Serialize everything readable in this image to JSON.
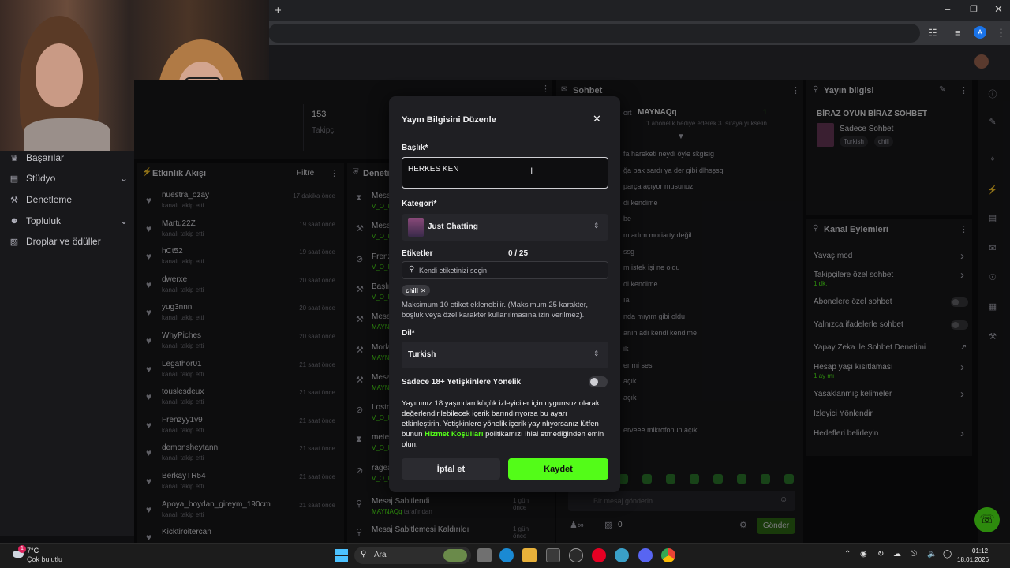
{
  "browser": {
    "new_tab": "+",
    "avatar_letter": "A"
  },
  "sidebar": {
    "items": [
      {
        "label": "Başarılar",
        "icon": "trophy-icon"
      },
      {
        "label": "Stüdyo",
        "icon": "studio-icon",
        "expand": true
      },
      {
        "label": "Denetleme",
        "icon": "wrench-icon"
      },
      {
        "label": "Topluluk",
        "icon": "community-icon",
        "expand": true
      },
      {
        "label": "Droplar ve ödüller",
        "icon": "gift-icon"
      }
    ]
  },
  "stats": {
    "value": "153",
    "label": "Takipçi"
  },
  "activity": {
    "title": "Etkinlik Akışı",
    "filter": "Filtre",
    "rows": [
      {
        "name": "nuestra_ozay",
        "sub": "kanalı takip etti",
        "time": "17 dakika önce"
      },
      {
        "name": "Martu22Z",
        "sub": "kanalı takip etti",
        "time": "19 saat önce"
      },
      {
        "name": "hCt52",
        "sub": "kanalı takip etti",
        "time": "19 saat önce"
      },
      {
        "name": "dwerxe",
        "sub": "kanalı takip etti",
        "time": "20 saat önce"
      },
      {
        "name": "yug3nnn",
        "sub": "kanalı takip etti",
        "time": "20 saat önce"
      },
      {
        "name": "WhyPiches",
        "sub": "kanalı takip etti",
        "time": "20 saat önce"
      },
      {
        "name": "Legathor01",
        "sub": "kanalı takip etti",
        "time": "21 saat önce"
      },
      {
        "name": "touslesdeux",
        "sub": "kanalı takip etti",
        "time": "21 saat önce"
      },
      {
        "name": "Frenzyy1v9",
        "sub": "kanalı takip etti",
        "time": "21 saat önce"
      },
      {
        "name": "demonsheytann",
        "sub": "kanalı takip etti",
        "time": "21 saat önce"
      },
      {
        "name": "BerkayTR54",
        "sub": "kanalı takip etti",
        "time": "21 saat önce"
      },
      {
        "name": "Apoya_boydan_gireym_190cm",
        "sub": "kanalı takip etti",
        "time": "21 saat önce"
      },
      {
        "name": "Kicktiroitercan",
        "sub": "",
        "time": ""
      }
    ]
  },
  "moderation": {
    "title": "Denetim",
    "rows": [
      {
        "name": "Mesa",
        "user": "V_O_F"
      },
      {
        "name": "Mesa",
        "user": "V_O_F"
      },
      {
        "name": "Frenz",
        "user": "V_O_F"
      },
      {
        "name": "Başlı",
        "user": "V_O_F"
      },
      {
        "name": "Mesa",
        "user": "MAYN"
      },
      {
        "name": "Morla",
        "user": "MAYN"
      },
      {
        "name": "Mesa",
        "user": "MAYN"
      },
      {
        "name": "Lostr",
        "user": "V_O_F"
      },
      {
        "name": "mete",
        "user": "V_O_F"
      },
      {
        "name": "ragea",
        "user": "V_O_F"
      }
    ],
    "pinned": {
      "name": "Mesaj Sabitlendi",
      "user": "MAYNAQq",
      "suffix": "tarafından",
      "time": "1 gün önce"
    },
    "unpinned": {
      "name": "Mesaj Sabitlemesi Kaldırıldı",
      "time": "1 gün önce"
    }
  },
  "chat": {
    "title": "Sohbet",
    "top_user": "MAYNAQq",
    "top_prefix": "ort",
    "top_count": "1",
    "top_line": "1 abonelik hediye ederek 3. sıraya yükselin",
    "lines": [
      "fa hareketi neydi öyle skgisig",
      "ğa bak sardı ya der gibi dlhsşsg",
      "parça açıyor musunuz",
      "di kendime",
      "be",
      "m adım moriarty değil",
      "ssg",
      "m istek işi ne oldu",
      "di kendime",
      "ıa",
      "nda mıyım gibi oldu",
      "anın adı kendi kendime",
      "ik",
      "er mi ses",
      "açık",
      "açık",
      "",
      "erveee mikrofonun açık"
    ],
    "input_placeholder": "Bir mesaj gönderin",
    "coins": "0",
    "send": "Gönder"
  },
  "stream_info": {
    "title": "Yayın bilgisi",
    "stream_title": "BİRAZ OYUN BİRAZ SOHBET",
    "category": "Sadece Sohbet",
    "tags": [
      "Turkish",
      "chill"
    ]
  },
  "channel_actions": {
    "title": "Kanal Eylemleri",
    "rows": [
      {
        "label": "Yavaş mod",
        "control": "chevron"
      },
      {
        "label": "Takipçilere özel sohbet",
        "sub": "1 dk.",
        "control": "chevron"
      },
      {
        "label": "Abonelere özel sohbet",
        "control": "toggle"
      },
      {
        "label": "Yalnızca ifadelerle sohbet",
        "control": "toggle"
      },
      {
        "label": "Yapay Zeka ile Sohbet Denetimi",
        "control": "link"
      },
      {
        "label": "Hesap yaşı kısıtlaması",
        "sub": "1 ay mı",
        "control": "chevron"
      },
      {
        "label": "Yasaklanmış kelimeler",
        "control": "chevron"
      },
      {
        "label": "İzleyici Yönlendir",
        "control": "none"
      },
      {
        "label": "Hedefleri belirleyin",
        "control": "chevron"
      }
    ]
  },
  "modal": {
    "title": "Yayın Bilgisini Düzenle",
    "title_label": "Başlık*",
    "title_value": "HERKES KEN",
    "category_label": "Kategori*",
    "category_value": "Just Chatting",
    "tags_label": "Etiketler",
    "tags_count": "0 / 25",
    "tags_placeholder": "Kendi etiketinizi seçin",
    "tag_chip": "chill",
    "tags_help": "Maksimum 10 etiket eklenebilir. (Maksimum 25 karakter, boşluk veya özel karakter kullanılmasına izin verilmez).",
    "language_label": "Dil*",
    "language_value": "Turkish",
    "mature_label": "Sadece 18+ Yetişkinlere Yönelik",
    "mature_text_before": "Yayınınız 18 yaşından küçük izleyiciler için uygunsuz olarak değerlendirilebilecek içerik barındırıyorsa bu ayarı etkinleştirin. Yetişkinlere yönelik içerik yayınlıyorsanız lütfen bunun ",
    "mature_link": "Hizmet Koşulları",
    "mature_text_after": " politikamızı ihlal etmediğinden emin olun.",
    "cancel": "İptal et",
    "save": "Kaydet"
  },
  "taskbar": {
    "temp": "7°C",
    "weather": "Çok bulutlu",
    "weather_badge": "1",
    "search": "Ara",
    "time": "01:12",
    "date": "18.01.2026"
  },
  "colors": {
    "accent": "#53fc18",
    "bg": "#0e0e10",
    "panel": "#18181b",
    "modal": "#1f1f23"
  }
}
